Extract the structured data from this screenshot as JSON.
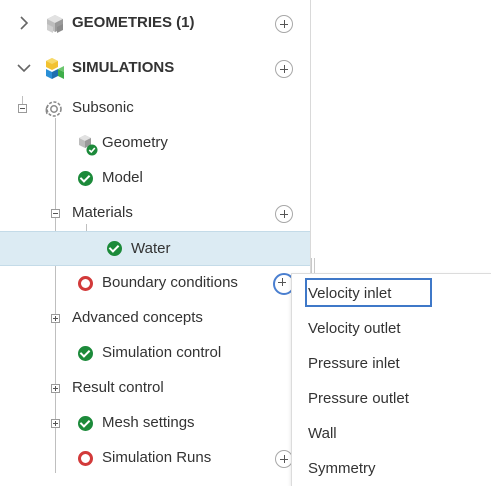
{
  "tree": {
    "geometries_label": "GEOMETRIES (1)",
    "simulations_label": "SIMULATIONS",
    "subsonic_label": "Subsonic",
    "items": {
      "geometry": "Geometry",
      "model": "Model",
      "materials": "Materials",
      "water": "Water",
      "boundary_conditions": "Boundary conditions",
      "advanced_concepts": "Advanced concepts",
      "simulation_control": "Simulation control",
      "result_control": "Result control",
      "mesh_settings": "Mesh settings",
      "simulation_runs": "Simulation Runs"
    }
  },
  "dropdown": {
    "options": [
      "Velocity inlet",
      "Velocity outlet",
      "Pressure inlet",
      "Pressure outlet",
      "Wall",
      "Symmetry"
    ],
    "highlighted": "Velocity inlet"
  },
  "colors": {
    "check_green": "#1c8a3a",
    "warning_red": "#d23a3a",
    "selected_row": "#dcebf3",
    "highlight_blue": "#3f78c8"
  }
}
